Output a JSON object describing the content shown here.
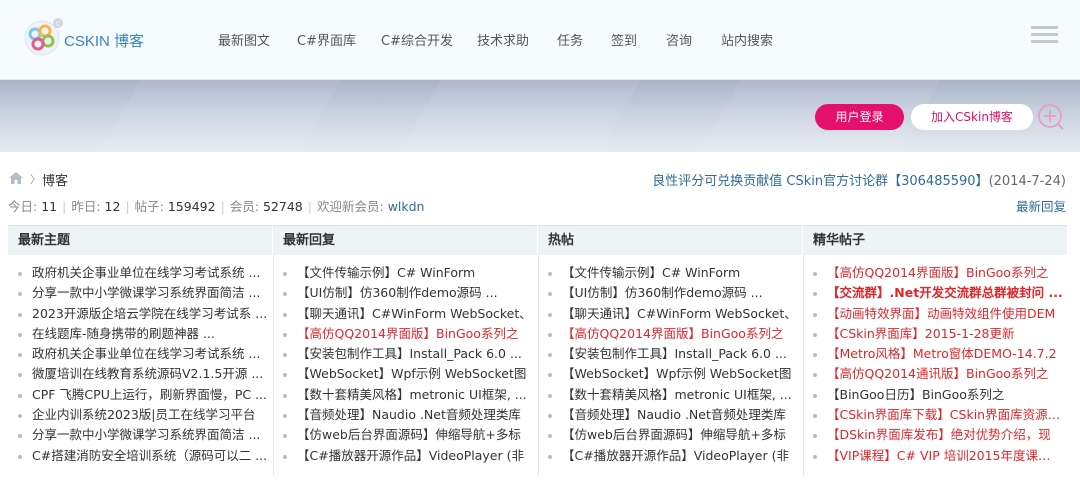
{
  "header": {
    "logo_text": "CSKIN 博客",
    "nav": [
      "最新图文",
      "C#界面库",
      "C#综合开发",
      "技术求助",
      "任务",
      "签到",
      "咨询",
      "站内搜索"
    ]
  },
  "banner": {
    "login_label": "用户登录",
    "join_label": "加入CSkin博客"
  },
  "breadcrumb": {
    "label": "博客"
  },
  "notice": {
    "text": "良性评分可兑换贡献值 CSkin官方讨论群【306485590】",
    "date": "(2014-7-24)"
  },
  "stats": {
    "today_label": "今日:",
    "today": "11",
    "yesterday_label": "昨日:",
    "yesterday": "12",
    "posts_label": "帖子:",
    "posts": "159492",
    "members_label": "会员:",
    "members": "52748",
    "welcome_label": "欢迎新会员:",
    "new_member": "wlkdn",
    "latest_reply": "最新回复"
  },
  "columns": [
    {
      "title": "最新主题",
      "items": [
        {
          "text": "政府机关企事业单位在线学习考试系统 ...",
          "style": "black"
        },
        {
          "text": "分享一款中小学微课学习系统界面简洁 ...",
          "style": "black"
        },
        {
          "text": "2023开源版企培云学院在线学习考试系 ...",
          "style": "black"
        },
        {
          "text": "在线题库-随身携带的刷题神器 ...",
          "style": "black"
        },
        {
          "text": "政府机关企事业单位在线学习考试系统 ...",
          "style": "black"
        },
        {
          "text": "微厦培训在线教育系统源码V2.1.5开源 ...",
          "style": "black"
        },
        {
          "text": "CPF 飞腾CPU上运行，刷新界面慢，PC ...",
          "style": "black"
        },
        {
          "text": "企业内训系统2023版|员工在线学习平台",
          "style": "black"
        },
        {
          "text": "分享一款中小学微课学习系统界面简洁 ...",
          "style": "black"
        },
        {
          "text": "C#搭建消防安全培训系统（源码可以二 ...",
          "style": "black"
        }
      ]
    },
    {
      "title": "最新回复",
      "items": [
        {
          "text": "【文件传输示例】C# WinForm",
          "style": "black"
        },
        {
          "text": "【UI仿制】仿360制作demo源码 ...",
          "style": "black"
        },
        {
          "text": "【聊天通讯】C#WinForm WebSocket、",
          "style": "black"
        },
        {
          "text": "【高仿QQ2014界面版】BinGoo系列之",
          "style": "red"
        },
        {
          "text": "【安装包制作工具】Install_Pack 6.0 ...",
          "style": "black"
        },
        {
          "text": "【WebSocket】Wpf示例 WebSocket图",
          "style": "black"
        },
        {
          "text": "【数十套精美风格】metronic UI框架, ...",
          "style": "black"
        },
        {
          "text": "【音频处理】Naudio .Net音频处理类库",
          "style": "black"
        },
        {
          "text": "【仿web后台界面源码】伸缩导航+多标",
          "style": "black"
        },
        {
          "text": "【C#播放器开源作品】VideoPlayer (非",
          "style": "black"
        }
      ]
    },
    {
      "title": "热帖",
      "items": [
        {
          "text": "【文件传输示例】C# WinForm",
          "style": "black"
        },
        {
          "text": "【UI仿制】仿360制作demo源码 ...",
          "style": "black"
        },
        {
          "text": "【聊天通讯】C#WinForm WebSocket、",
          "style": "black"
        },
        {
          "text": "【高仿QQ2014界面版】BinGoo系列之",
          "style": "red"
        },
        {
          "text": "【安装包制作工具】Install_Pack 6.0 ...",
          "style": "black"
        },
        {
          "text": "【WebSocket】Wpf示例 WebSocket图",
          "style": "black"
        },
        {
          "text": "【数十套精美风格】metronic UI框架, ...",
          "style": "black"
        },
        {
          "text": "【音频处理】Naudio .Net音频处理类库",
          "style": "black"
        },
        {
          "text": "【仿web后台界面源码】伸缩导航+多标",
          "style": "black"
        },
        {
          "text": "【C#播放器开源作品】VideoPlayer (非",
          "style": "black"
        }
      ]
    },
    {
      "title": "精华帖子",
      "items": [
        {
          "text": "【高仿QQ2014界面版】BinGoo系列之",
          "style": "red"
        },
        {
          "text": "【交流群】.Net开发交流群总群被封问 ...",
          "style": "bold-red"
        },
        {
          "text": "【动画特效界面】动画特效组件使用DEM",
          "style": "red"
        },
        {
          "text": "【CSkin界面库】2015-1-28更新",
          "style": "red"
        },
        {
          "text": "【Metro风格】Metro窗体DEMO-14.7.2",
          "style": "red"
        },
        {
          "text": "【高仿QQ2014通讯版】BinGoo系列之",
          "style": "red"
        },
        {
          "text": "【BinGoo日历】BinGoo系列之",
          "style": "black"
        },
        {
          "text": "【CSkin界面库下载】CSkin界面库资源 ...",
          "style": "red"
        },
        {
          "text": "【DSkin界面库发布】绝对优势介绍，现",
          "style": "red"
        },
        {
          "text": "【VIP课程】C# VIP 培训2015年度课程 ...",
          "style": "red"
        }
      ]
    }
  ],
  "colors": {
    "accent": "#e5106b",
    "link": "#2f6b9a",
    "highlight_red": "#e0262b"
  }
}
